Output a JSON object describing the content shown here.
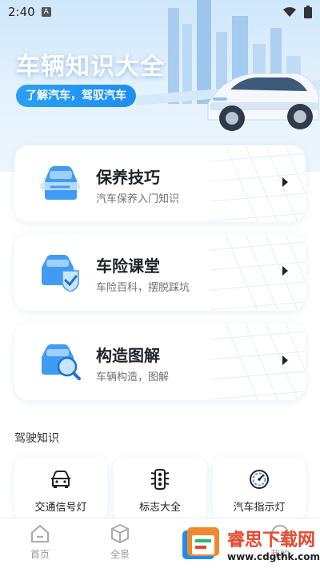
{
  "status_bar": {
    "time": "2:40",
    "app_badge": "A"
  },
  "hero": {
    "title": "车辆知识大全",
    "subtitle": "了解汽车，驾驭汽车"
  },
  "cards": [
    {
      "title": "保养技巧",
      "desc": "汽车保养入门知识",
      "icon": "car-wrench-icon"
    },
    {
      "title": "车险课堂",
      "desc": "车险百科，摆脱踩坑",
      "icon": "car-shield-icon"
    },
    {
      "title": "构造图解",
      "desc": "车辆构造，图解",
      "icon": "car-magnifier-icon"
    }
  ],
  "section": {
    "title": "驾驶知识"
  },
  "quick_items": [
    {
      "label": "交通信号灯",
      "icon": "car-front-icon"
    },
    {
      "label": "标志大全",
      "icon": "traffic-light-icon"
    },
    {
      "label": "汽车指示灯",
      "icon": "gauge-icon"
    }
  ],
  "tabs": [
    {
      "label": "首页",
      "icon": "home-icon"
    },
    {
      "label": "全景",
      "icon": "cube-icon"
    },
    {
      "label": "我的",
      "icon": "user-icon"
    }
  ],
  "watermark": {
    "title": "睿思下载网",
    "url": "www.cdgthk.com"
  },
  "colors": {
    "accent": "#1f8ef0",
    "card_icon": "#3f9cf2",
    "watermark": "#e8462c"
  }
}
